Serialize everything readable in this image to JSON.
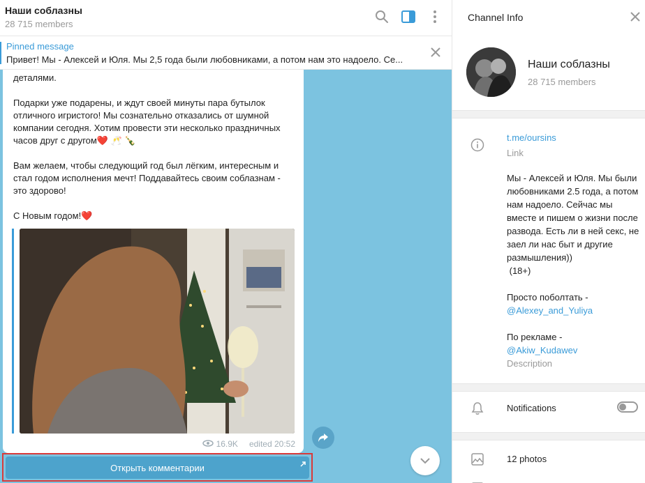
{
  "chat": {
    "title": "Наши соблазны",
    "members": "28 715 members"
  },
  "pinned": {
    "title": "Pinned message",
    "text": "Привет! Мы - Алексей и Юля. Мы 2,5 года были любовниками, а потом нам это надоело. Се..."
  },
  "message": {
    "text": "деталями.\n\nПодарки уже подарены, и ждут своей минуты пара бутылок отличного игристого! Мы сознательно отказались от шумной компании сегодня. Хотим провести эти несколько праздничных часов друг с другом❤️ 🥂 🍾\n\nВам желаем, чтобы следующий год был лёгким, интересным и стал годом исполнения мечт! Поддавайтесь своим соблазнам - это здорово!\n\nС Новым годом!❤️",
    "views": "16.9K",
    "edited": "edited 20:52"
  },
  "comments_button": "Открыть комментарии",
  "info": {
    "header": "Channel Info",
    "name": "Наши соблазны",
    "members": "28 715 members",
    "link": "t.me/oursins",
    "link_label": "Link",
    "description_main": "Мы - Алексей и Юля. Мы были любовниками 2.5 года, а потом нам надоело. Сейчас мы вместе и пишем о жизни после развода. Есть ли в ней секс, не заел ли нас быт и другие размышления))\n (18+)\n\nПросто поболтать -",
    "contact_1": "@Alexey_and_Yuliya",
    "ads_label": "По рекламе -",
    "contact_2": "@Akiw_Kudawev",
    "description_label": "Description",
    "notifications_label": "Notifications",
    "notifications_on": false,
    "photos_label": "12 photos"
  },
  "colors": {
    "accent": "#3a9bd8",
    "chat_bg": "#7cc3e0",
    "highlight_border": "#d93a3a"
  }
}
